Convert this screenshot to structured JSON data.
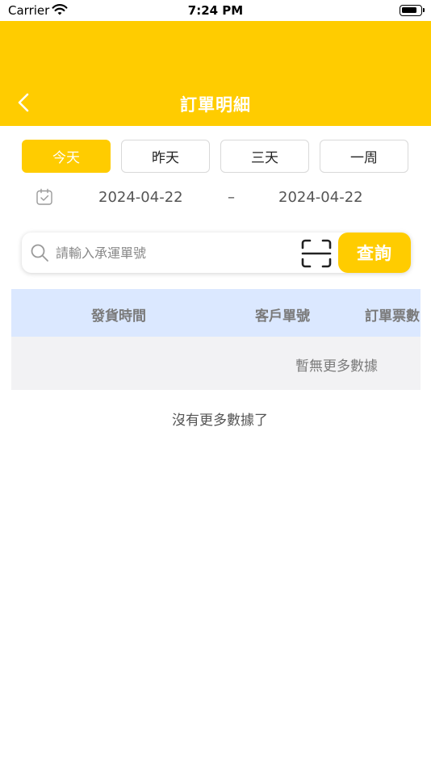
{
  "status_bar": {
    "carrier": "Carrier",
    "time": "7:24 PM",
    "wifi_icon": "wifi-icon",
    "battery_icon": "battery-icon"
  },
  "nav": {
    "title": "訂單明細",
    "back_icon": "chevron-left-icon"
  },
  "range_tabs": [
    {
      "label": "今天",
      "active": true
    },
    {
      "label": "昨天",
      "active": false
    },
    {
      "label": "三天",
      "active": false
    },
    {
      "label": "一周",
      "active": false
    }
  ],
  "date_range": {
    "calendar_icon": "calendar-icon",
    "start": "2024-04-22",
    "separator": "–",
    "end": "2024-04-22"
  },
  "search": {
    "placeholder": "請輸入承運單號",
    "value": "",
    "search_icon": "search-icon",
    "scan_icon": "scan-icon",
    "button_label": "查詢"
  },
  "table": {
    "columns": [
      "發貨時間",
      "客戶單號",
      "訂單票數"
    ],
    "empty_text": "暫無更多數據"
  },
  "footer": {
    "no_more_text": "沒有更多數據了"
  },
  "colors": {
    "accent": "#ffcc00",
    "table_header_bg": "#dbe8ff",
    "empty_row_bg": "#f2f2f4"
  }
}
